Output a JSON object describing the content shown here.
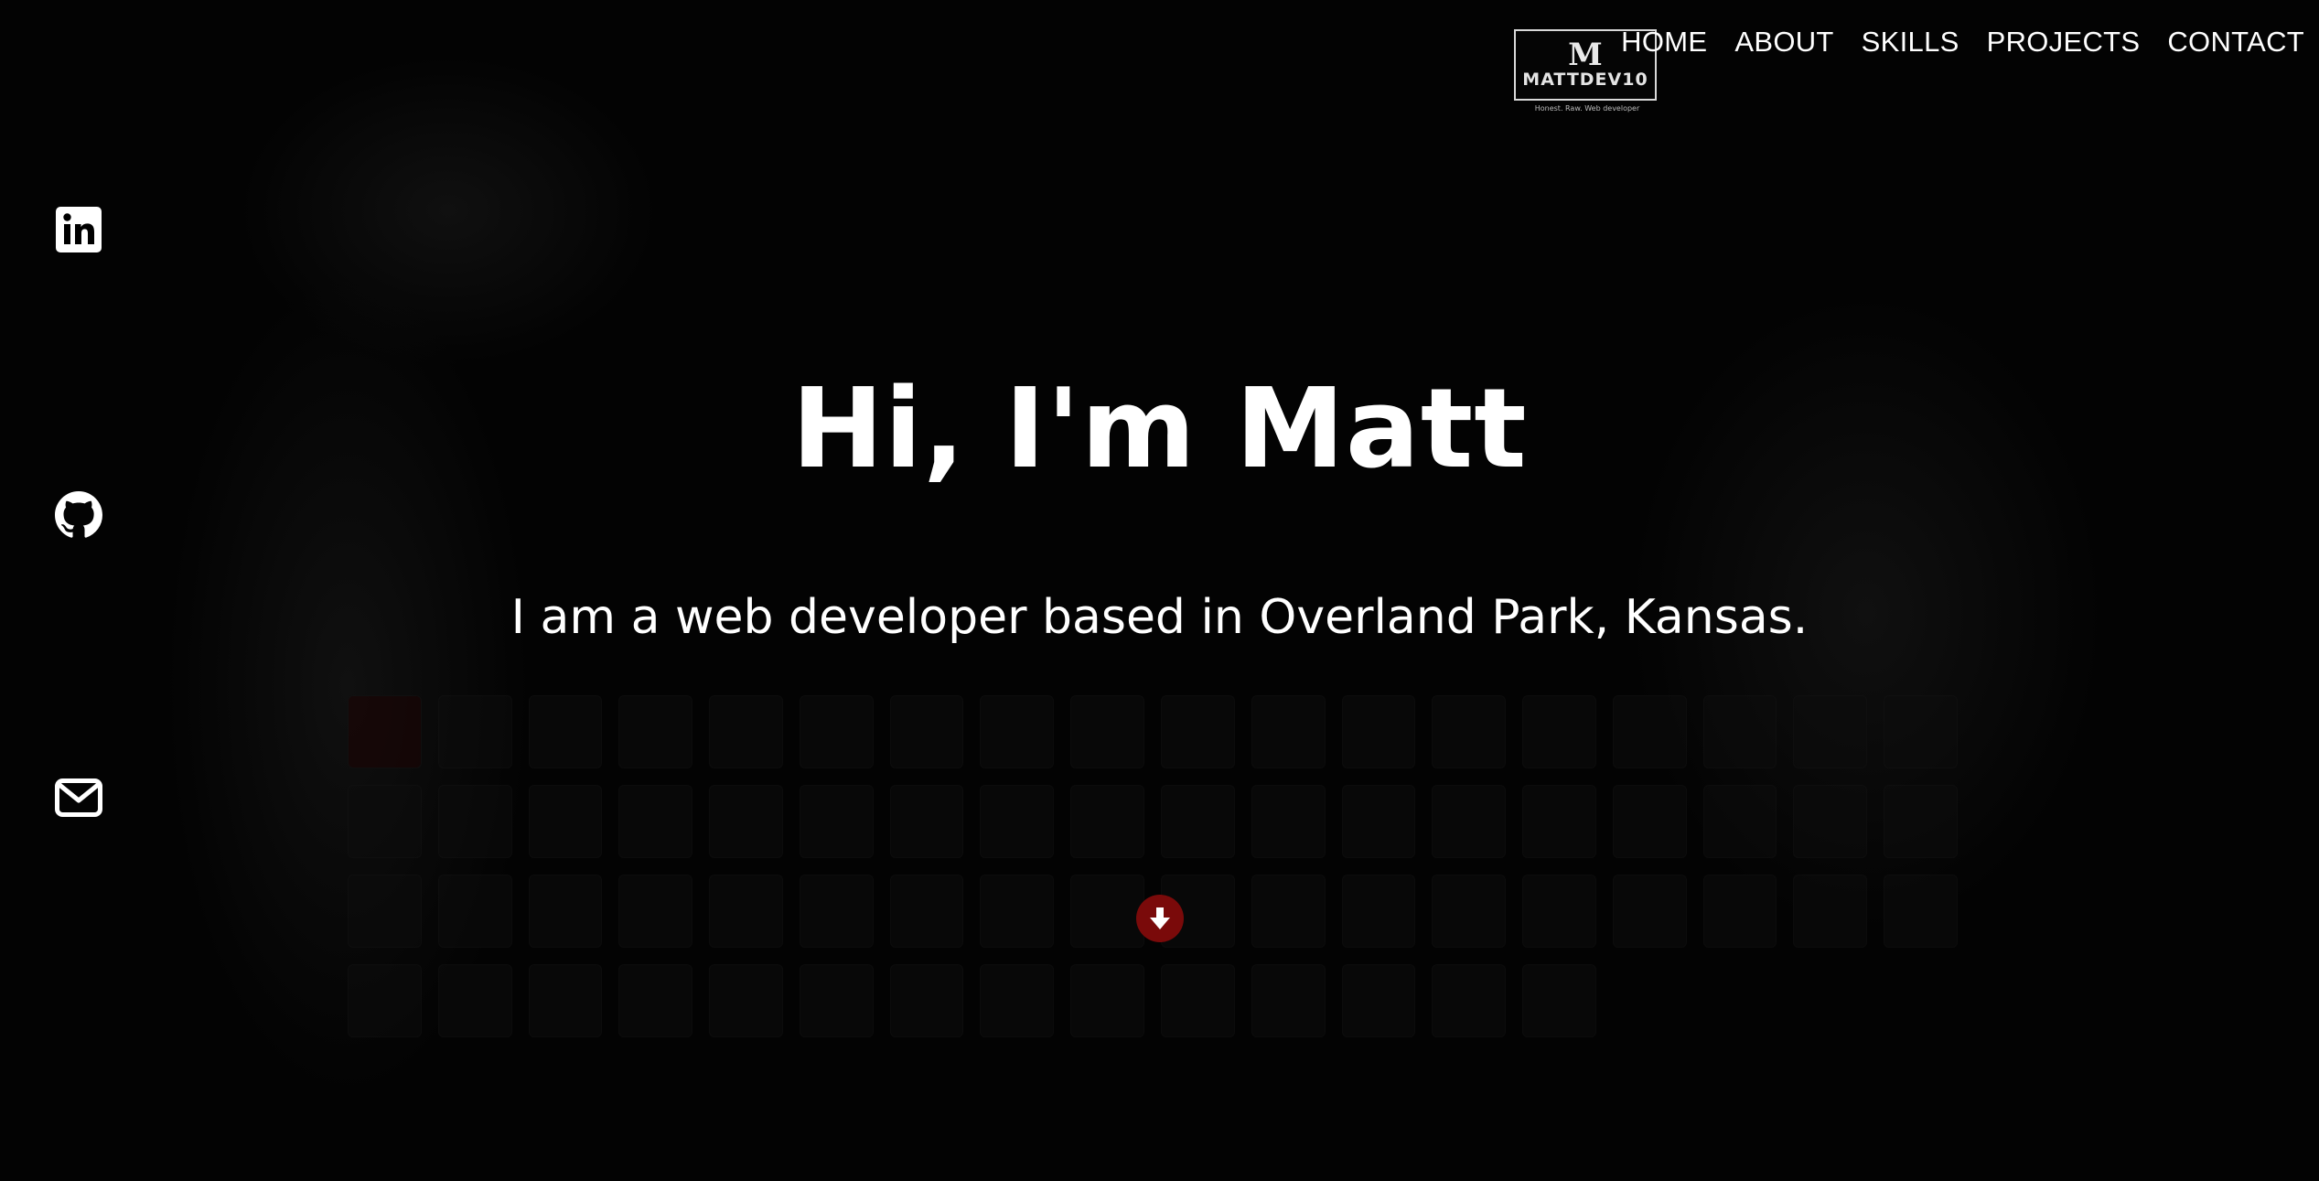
{
  "brand": {
    "mark": "M",
    "name": "MATTDEV10",
    "tagline": "Honest. Raw. Web developer"
  },
  "nav": {
    "items": [
      {
        "label": "HOME"
      },
      {
        "label": "ABOUT"
      },
      {
        "label": "SKILLS"
      },
      {
        "label": "PROJECTS"
      },
      {
        "label": "CONTACT"
      }
    ]
  },
  "social": [
    {
      "icon": "linkedin-icon"
    },
    {
      "icon": "github-icon"
    },
    {
      "icon": "mail-icon"
    }
  ],
  "hero": {
    "title": "Hi, I'm Matt",
    "subtitle": "I am a web developer based in Overland Park, Kansas."
  },
  "scroll_button": {
    "icon": "arrow-down-icon",
    "color": "#7a0a0a"
  }
}
